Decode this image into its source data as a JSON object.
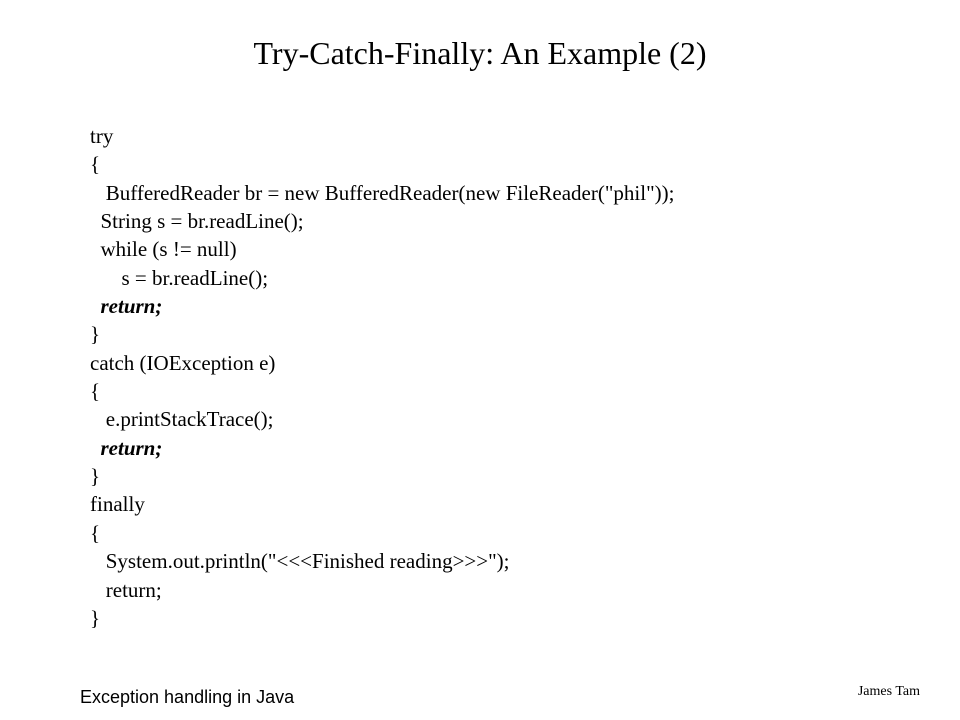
{
  "slide": {
    "title": "Try-Catch-Finally: An Example (2)",
    "code": {
      "l01": "try",
      "l02": "{",
      "l03": "   BufferedReader br = new BufferedReader(new FileReader(\"phil\"));",
      "l04": "  String s = br.readLine();",
      "l05": "  while (s != null)",
      "l06": "      s = br.readLine();",
      "l07": "  return;",
      "l08": "}",
      "l09": "catch (IOException e)",
      "l10": "{",
      "l11": "   e.printStackTrace();",
      "l12": "  return;",
      "l13": "}",
      "l14": "finally",
      "l15": "{",
      "l16": "   System.out.println(\"<<<Finished reading>>>\");",
      "l17": "   return;",
      "l18": "}"
    },
    "footer_left": "Exception handling in Java",
    "footer_right": "James Tam"
  }
}
